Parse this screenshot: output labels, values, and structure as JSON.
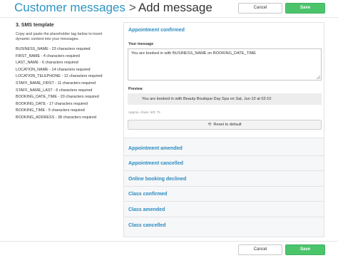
{
  "header": {
    "breadcrumb": "Customer messages",
    "separator": ">",
    "current": "Add message",
    "cancel_label": "Cancel",
    "save_label": "Save"
  },
  "template": {
    "heading": "3. SMS template",
    "description": "Copy and paste the placeholder tag below to insert dynamic content into your messages.",
    "placeholders": [
      "BUSINESS_NAME - 23 characters required",
      "FIRST_NAME - 4 characters required",
      "LAST_NAME - 6 characters required",
      "LOCATION_NAME - 14 characters required",
      "LOCATION_TELEPHONE - 12 characters required",
      "STAFF_NAME_FIRST - 11 characters required",
      "STAFF_NAME_LAST - 6 characters required",
      "BOOKING_DATE_TIME - 20 characters required",
      "BOOKING_DATE - 17 characters required",
      "BOOKING_TIME - 5 characters required",
      "BOOKING_ADDRESS - 38 characters required"
    ]
  },
  "editor": {
    "open_section": "Appointment confirmed",
    "message_label": "Your message",
    "message_value": "You are booked in with BUSINESS_NAME on BOOKING_DATE_TIME",
    "preview_label": "Preview",
    "preview_text": "You are booked in with Beauty Boutique Day Spa on Sat, Jun 10 at 02:10",
    "approx_chars": "Approx. chars. left: 73",
    "reset_label": "Reset to default",
    "sections": [
      "Appointment amended",
      "Appointment cancelled",
      "Online booking declined",
      "Class confirmed",
      "Class amended",
      "Class cancelled"
    ]
  },
  "footer": {
    "cancel_label": "Cancel",
    "save_label": "Save"
  },
  "colors": {
    "accent_blue": "#2b94c3",
    "save_green": "#4cc46c"
  }
}
